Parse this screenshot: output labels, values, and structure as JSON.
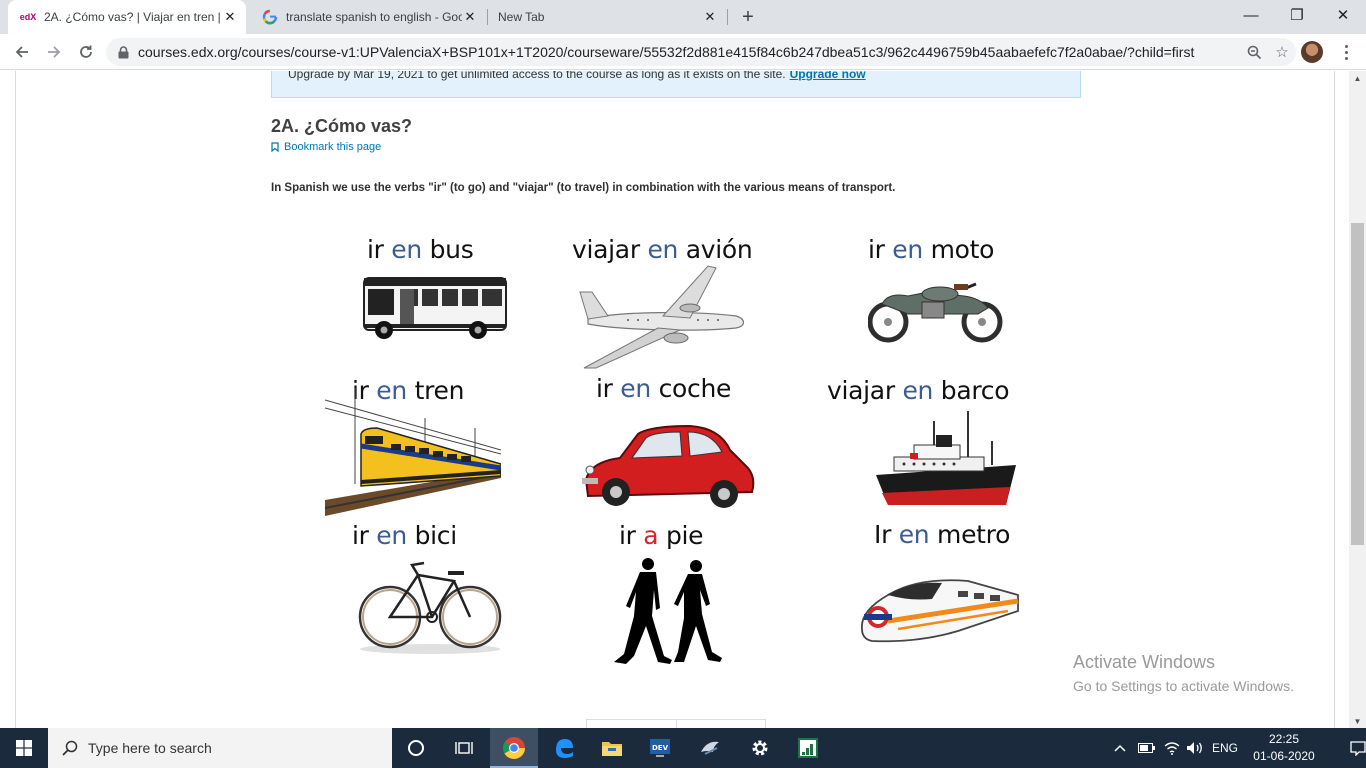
{
  "browser": {
    "tabs": [
      {
        "title": "2A. ¿Cómo vas? | Viajar en tren | UPValenciaX",
        "favicon": "edx-logo-icon",
        "favicon_text": "edX",
        "active": true
      },
      {
        "title": "translate spanish to english - Google Search",
        "favicon": "google-icon",
        "active": false
      },
      {
        "title": "New Tab",
        "favicon": "",
        "active": false
      }
    ],
    "new_tab_symbol": "+",
    "window_controls": {
      "minimize": "—",
      "maximize": "❐",
      "close": "✕"
    },
    "url": "courses.edx.org/courses/course-v1:UPValenciaX+BSP101x+1T2020/courseware/55532f2d881e415f84c6b247dbea51c3/962c4496759b45aabaefefc7f2a0abae/?child=first"
  },
  "page": {
    "upgrade_text": "Upgrade by Mar 19, 2021 to get unlimited access to the course as long as it exists on the site.",
    "upgrade_link": "Upgrade now",
    "unit_title": "2A. ¿Cómo vas?",
    "bookmark_label": "Bookmark this page",
    "intro": "In Spanish we use the verbs \"ir\" (to go) and \"viajar\" (to travel) in combination with the various means of transport.",
    "transport": [
      {
        "verb": "ir",
        "prep": "en",
        "noun": "bus",
        "icon": "bus-icon"
      },
      {
        "verb": "viajar",
        "prep": "en",
        "noun": "avión",
        "icon": "airplane-icon"
      },
      {
        "verb": "ir",
        "prep": "en",
        "noun": "moto",
        "icon": "motorcycle-icon"
      },
      {
        "verb": "ir",
        "prep": "en",
        "noun": "tren",
        "icon": "train-icon"
      },
      {
        "verb": "ir",
        "prep": "en",
        "noun": "coche",
        "icon": "car-icon"
      },
      {
        "verb": "viajar",
        "prep": "en",
        "noun": "barco",
        "icon": "ship-icon"
      },
      {
        "verb": "ir",
        "prep": "en",
        "noun": "bici",
        "icon": "bicycle-icon"
      },
      {
        "verb": "ir",
        "prep": "a",
        "noun": "pie",
        "icon": "walking-people-icon"
      },
      {
        "verb": "Ir",
        "prep": "en",
        "noun": "metro",
        "icon": "metro-train-icon"
      }
    ],
    "colors": {
      "prep_blue": "#3c5c94",
      "prep_red": "#d6262a",
      "link": "#0075b4"
    }
  },
  "watermark": {
    "line1": "Activate Windows",
    "line2": "Go to Settings to activate Windows."
  },
  "taskbar": {
    "search_placeholder": "Type here to search",
    "language": "ENG",
    "time": "22:25",
    "date": "01-06-2020"
  }
}
